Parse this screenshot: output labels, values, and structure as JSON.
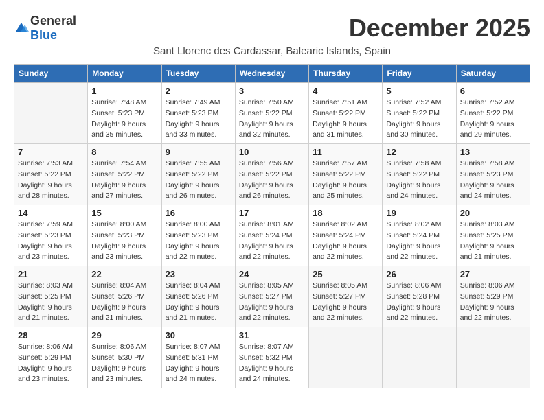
{
  "header": {
    "logo_general": "General",
    "logo_blue": "Blue",
    "title": "December 2025",
    "subtitle": "Sant Llorenc des Cardassar, Balearic Islands, Spain"
  },
  "columns": [
    "Sunday",
    "Monday",
    "Tuesday",
    "Wednesday",
    "Thursday",
    "Friday",
    "Saturday"
  ],
  "weeks": [
    [
      {
        "day": "",
        "info": ""
      },
      {
        "day": "1",
        "info": "Sunrise: 7:48 AM\nSunset: 5:23 PM\nDaylight: 9 hours\nand 35 minutes."
      },
      {
        "day": "2",
        "info": "Sunrise: 7:49 AM\nSunset: 5:23 PM\nDaylight: 9 hours\nand 33 minutes."
      },
      {
        "day": "3",
        "info": "Sunrise: 7:50 AM\nSunset: 5:22 PM\nDaylight: 9 hours\nand 32 minutes."
      },
      {
        "day": "4",
        "info": "Sunrise: 7:51 AM\nSunset: 5:22 PM\nDaylight: 9 hours\nand 31 minutes."
      },
      {
        "day": "5",
        "info": "Sunrise: 7:52 AM\nSunset: 5:22 PM\nDaylight: 9 hours\nand 30 minutes."
      },
      {
        "day": "6",
        "info": "Sunrise: 7:52 AM\nSunset: 5:22 PM\nDaylight: 9 hours\nand 29 minutes."
      }
    ],
    [
      {
        "day": "7",
        "info": "Sunrise: 7:53 AM\nSunset: 5:22 PM\nDaylight: 9 hours\nand 28 minutes."
      },
      {
        "day": "8",
        "info": "Sunrise: 7:54 AM\nSunset: 5:22 PM\nDaylight: 9 hours\nand 27 minutes."
      },
      {
        "day": "9",
        "info": "Sunrise: 7:55 AM\nSunset: 5:22 PM\nDaylight: 9 hours\nand 26 minutes."
      },
      {
        "day": "10",
        "info": "Sunrise: 7:56 AM\nSunset: 5:22 PM\nDaylight: 9 hours\nand 26 minutes."
      },
      {
        "day": "11",
        "info": "Sunrise: 7:57 AM\nSunset: 5:22 PM\nDaylight: 9 hours\nand 25 minutes."
      },
      {
        "day": "12",
        "info": "Sunrise: 7:58 AM\nSunset: 5:22 PM\nDaylight: 9 hours\nand 24 minutes."
      },
      {
        "day": "13",
        "info": "Sunrise: 7:58 AM\nSunset: 5:23 PM\nDaylight: 9 hours\nand 24 minutes."
      }
    ],
    [
      {
        "day": "14",
        "info": "Sunrise: 7:59 AM\nSunset: 5:23 PM\nDaylight: 9 hours\nand 23 minutes."
      },
      {
        "day": "15",
        "info": "Sunrise: 8:00 AM\nSunset: 5:23 PM\nDaylight: 9 hours\nand 23 minutes."
      },
      {
        "day": "16",
        "info": "Sunrise: 8:00 AM\nSunset: 5:23 PM\nDaylight: 9 hours\nand 22 minutes."
      },
      {
        "day": "17",
        "info": "Sunrise: 8:01 AM\nSunset: 5:24 PM\nDaylight: 9 hours\nand 22 minutes."
      },
      {
        "day": "18",
        "info": "Sunrise: 8:02 AM\nSunset: 5:24 PM\nDaylight: 9 hours\nand 22 minutes."
      },
      {
        "day": "19",
        "info": "Sunrise: 8:02 AM\nSunset: 5:24 PM\nDaylight: 9 hours\nand 22 minutes."
      },
      {
        "day": "20",
        "info": "Sunrise: 8:03 AM\nSunset: 5:25 PM\nDaylight: 9 hours\nand 21 minutes."
      }
    ],
    [
      {
        "day": "21",
        "info": "Sunrise: 8:03 AM\nSunset: 5:25 PM\nDaylight: 9 hours\nand 21 minutes."
      },
      {
        "day": "22",
        "info": "Sunrise: 8:04 AM\nSunset: 5:26 PM\nDaylight: 9 hours\nand 21 minutes."
      },
      {
        "day": "23",
        "info": "Sunrise: 8:04 AM\nSunset: 5:26 PM\nDaylight: 9 hours\nand 21 minutes."
      },
      {
        "day": "24",
        "info": "Sunrise: 8:05 AM\nSunset: 5:27 PM\nDaylight: 9 hours\nand 22 minutes."
      },
      {
        "day": "25",
        "info": "Sunrise: 8:05 AM\nSunset: 5:27 PM\nDaylight: 9 hours\nand 22 minutes."
      },
      {
        "day": "26",
        "info": "Sunrise: 8:06 AM\nSunset: 5:28 PM\nDaylight: 9 hours\nand 22 minutes."
      },
      {
        "day": "27",
        "info": "Sunrise: 8:06 AM\nSunset: 5:29 PM\nDaylight: 9 hours\nand 22 minutes."
      }
    ],
    [
      {
        "day": "28",
        "info": "Sunrise: 8:06 AM\nSunset: 5:29 PM\nDaylight: 9 hours\nand 23 minutes."
      },
      {
        "day": "29",
        "info": "Sunrise: 8:06 AM\nSunset: 5:30 PM\nDaylight: 9 hours\nand 23 minutes."
      },
      {
        "day": "30",
        "info": "Sunrise: 8:07 AM\nSunset: 5:31 PM\nDaylight: 9 hours\nand 24 minutes."
      },
      {
        "day": "31",
        "info": "Sunrise: 8:07 AM\nSunset: 5:32 PM\nDaylight: 9 hours\nand 24 minutes."
      },
      {
        "day": "",
        "info": ""
      },
      {
        "day": "",
        "info": ""
      },
      {
        "day": "",
        "info": ""
      }
    ]
  ]
}
